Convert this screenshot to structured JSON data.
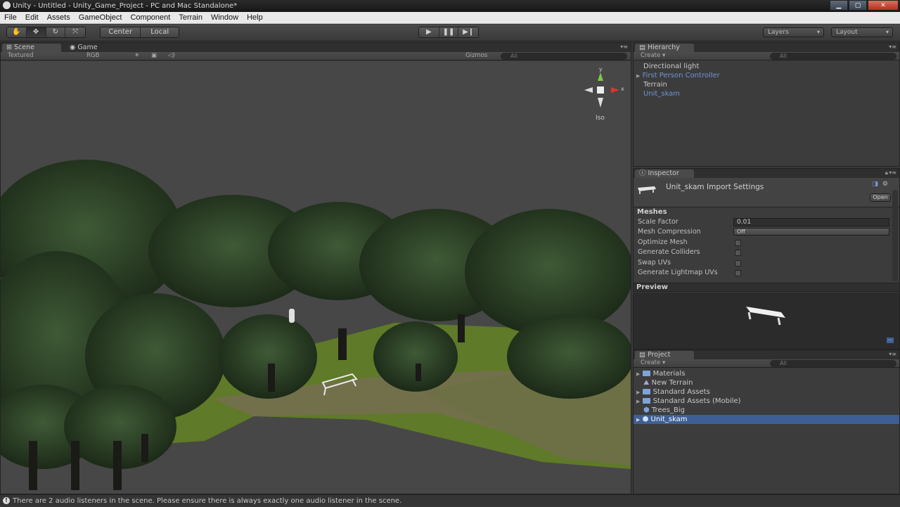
{
  "window": {
    "title": "Unity - Untitled - Unity_Game_Project - PC and Mac Standalone*"
  },
  "menu": [
    "File",
    "Edit",
    "Assets",
    "GameObject",
    "Component",
    "Terrain",
    "Window",
    "Help"
  ],
  "toolbar": {
    "pivot_center": "Center",
    "pivot_local": "Local",
    "layers": "Layers",
    "layout": "Layout"
  },
  "scene_panel": {
    "tab_scene": "Scene",
    "tab_game": "Game",
    "draw_mode": "Textured",
    "render_mode": "RGB",
    "gizmos": "Gizmos",
    "search_placeholder": "All",
    "gizmo_axis_y": "y",
    "gizmo_axis_x": "x",
    "projection": "Iso"
  },
  "hierarchy": {
    "tab": "Hierarchy",
    "create": "Create",
    "search_placeholder": "All",
    "items": [
      {
        "label": "Directional light"
      },
      {
        "label": "First Person Controller"
      },
      {
        "label": "Terrain"
      },
      {
        "label": "Unit_skam"
      }
    ]
  },
  "inspector": {
    "tab": "Inspector",
    "header": "Unit_skam Import Settings",
    "open_button": "Open",
    "section": "Meshes",
    "rows": [
      {
        "label": "Scale Factor",
        "value": "0.01"
      },
      {
        "label": "Mesh Compression",
        "value": "Off"
      },
      {
        "label": "Optimize Mesh"
      },
      {
        "label": "Generate Colliders"
      },
      {
        "label": "Swap UVs"
      },
      {
        "label": "Generate Lightmap UVs"
      }
    ],
    "preview_label": "Preview"
  },
  "project": {
    "tab": "Project",
    "create": "Create",
    "search_placeholder": "All",
    "items": [
      {
        "label": "Materials"
      },
      {
        "label": "New Terrain"
      },
      {
        "label": "Standard Assets"
      },
      {
        "label": "Standard Assets (Mobile)"
      },
      {
        "label": "Trees_Big"
      },
      {
        "label": "Unit_skam"
      }
    ]
  },
  "status": {
    "message": "There are 2 audio listeners in the scene. Please ensure there is always exactly one audio listener in the scene."
  },
  "colors": {
    "selection": "#3e5f96",
    "prefab_blue": "#6f95d6",
    "panel": "#3c3c3c"
  }
}
